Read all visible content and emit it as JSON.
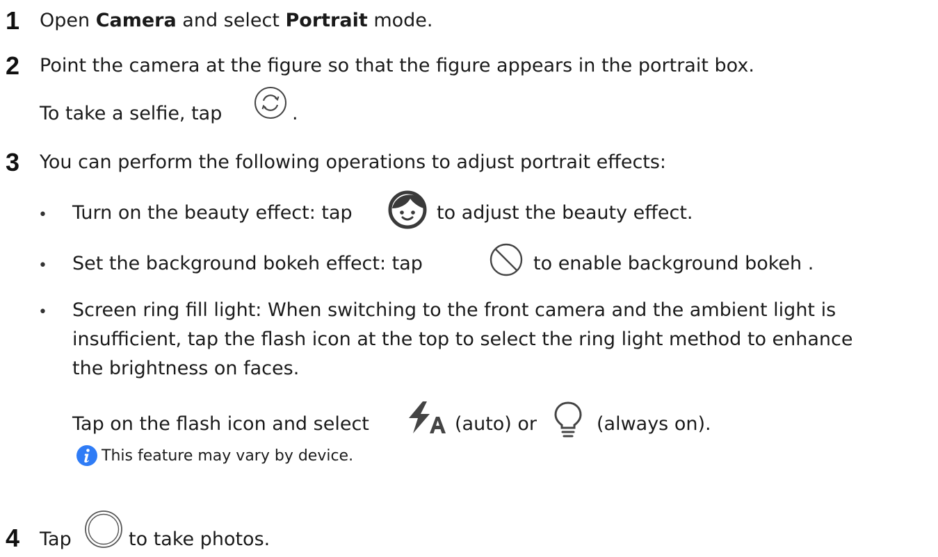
{
  "steps": [
    {
      "number": "1",
      "parts": [
        "Open ",
        "Camera",
        " and select ",
        "Portrait",
        " mode."
      ]
    },
    {
      "number": "2",
      "line1": "Point the camera at the figure so that the figure appears in the portrait box.",
      "line2_before": "To take a selfie, tap",
      "line2_after": "."
    },
    {
      "number": "3",
      "intro": "You can perform the following operations to adjust portrait effects:",
      "bullets": [
        {
          "marker": "•",
          "before": "Turn on the beauty effect: tap",
          "after": "to adjust the beauty effect."
        },
        {
          "marker": "•",
          "before": "Set the background bokeh effect: tap",
          "after": "to enable background bokeh ."
        },
        {
          "marker": "•",
          "lines": [
            "Screen ring fill light: When switching to the front camera and the ambient light is",
            "insufficient, tap the flash icon at the top to select the ring light method to enhance",
            "the brightness on faces."
          ]
        }
      ],
      "flash_before": "Tap on the flash icon and select",
      "flash_mid": "(auto) or",
      "flash_after": "(always on).",
      "note": "This feature may vary by device."
    },
    {
      "number": "4",
      "before": "Tap",
      "after": "to take photos."
    }
  ],
  "icons": {
    "switch_camera": "switch-camera-icon",
    "beauty": "beauty-face-icon",
    "bokeh": "bokeh-aperture-icon",
    "flash_auto": "flash-auto-icon",
    "ring_light": "ring-light-bulb-icon",
    "info": "info-icon",
    "shutter": "shutter-icon"
  },
  "colors": {
    "text": "#1a1a1a",
    "info_blue": "#2f7cf6",
    "icon_gray": "#4a4a4a"
  }
}
